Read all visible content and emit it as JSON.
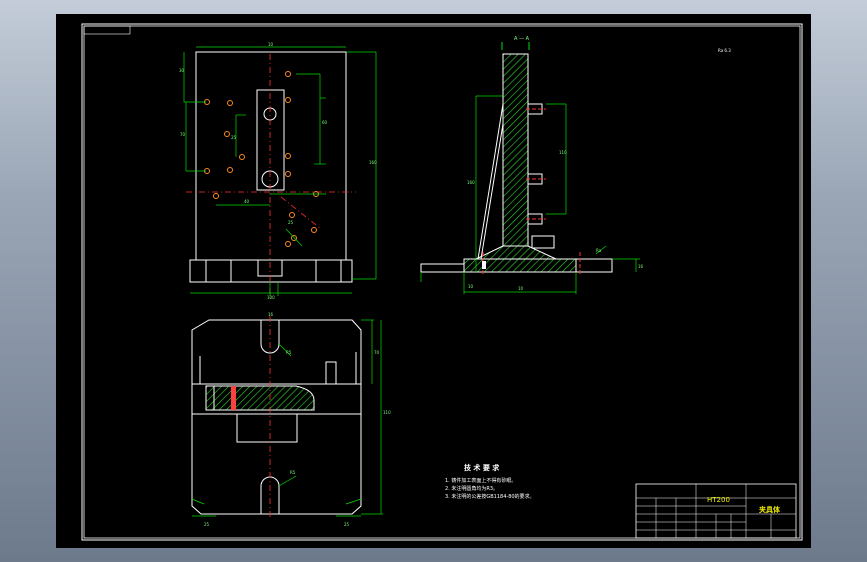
{
  "drawing": {
    "section_label": "A — A",
    "surface_symbol": "Ra 6.3",
    "tech_requirements": {
      "title": "技 术 要 求",
      "items": [
        "1. 铸件加工表面上不得有砂眼。",
        "2. 未注明圆角均为R3。",
        "3. 未注明的公差按GB1184-80的要求。"
      ]
    },
    "title_block": {
      "material": "HT200",
      "name": "夹具体"
    }
  },
  "colors": {
    "outline": "#ffffff",
    "dimension": "#00ff00",
    "center": "#ff3030",
    "hole": "#ff8c1a",
    "accent": "#ffff00"
  }
}
